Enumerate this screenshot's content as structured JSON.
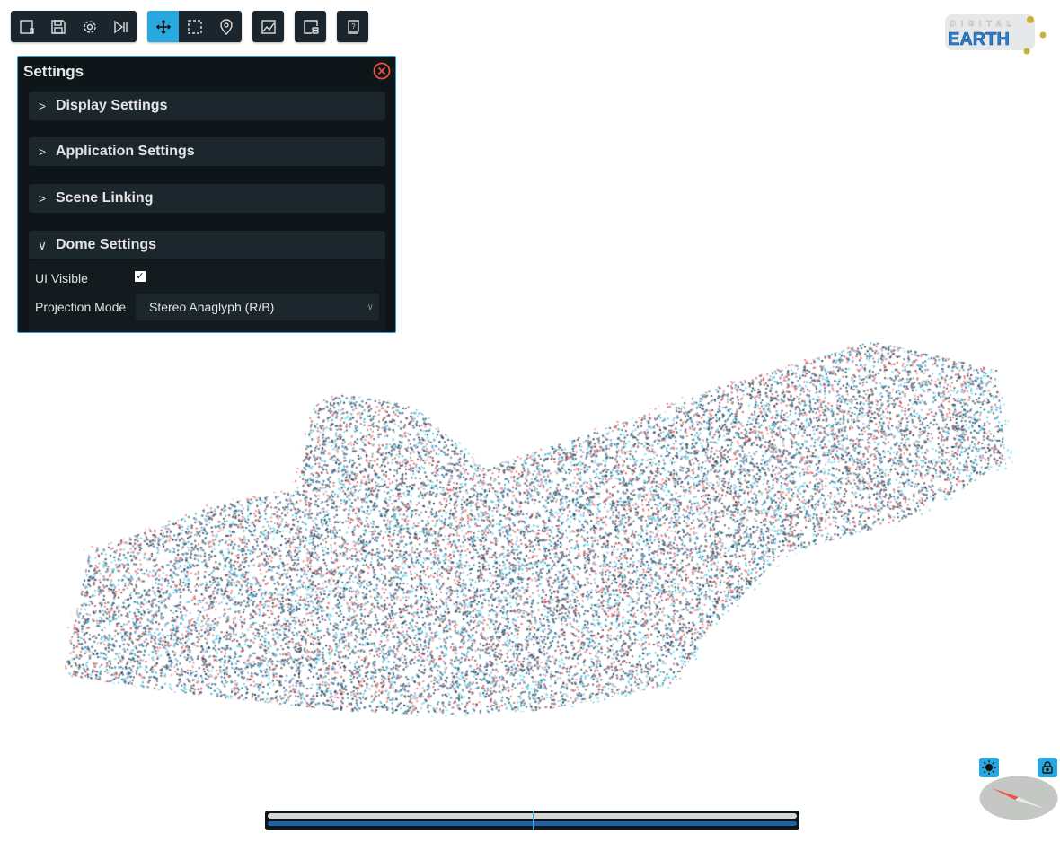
{
  "toolbar": {
    "groups": [
      {
        "buttons": [
          {
            "icon": "new-file-icon"
          },
          {
            "icon": "save-icon"
          },
          {
            "icon": "gear-icon"
          },
          {
            "icon": "play-pause-icon"
          }
        ]
      },
      {
        "buttons": [
          {
            "icon": "move-icon",
            "active": true
          },
          {
            "icon": "selection-box-icon"
          },
          {
            "icon": "location-pin-icon"
          }
        ]
      },
      {
        "buttons": [
          {
            "icon": "chart-icon"
          }
        ]
      },
      {
        "buttons": [
          {
            "icon": "layers-panel-icon"
          }
        ]
      },
      {
        "buttons": [
          {
            "icon": "help-book-icon"
          }
        ]
      }
    ],
    "accent_color": "#29a8e0"
  },
  "logo": {
    "text_top": "DIGITAL",
    "text_main": "EARTH"
  },
  "settings": {
    "title": "Settings",
    "sections": [
      {
        "label": "Display Settings",
        "expanded": false
      },
      {
        "label": "Application Settings",
        "expanded": false
      },
      {
        "label": "Scene Linking",
        "expanded": false
      },
      {
        "label": "Dome Settings",
        "expanded": true
      }
    ],
    "dome": {
      "ui_visible_label": "UI Visible",
      "ui_visible": true,
      "projection_label": "Projection Mode",
      "projection_value": "Stereo Anaglyph (R/B)"
    }
  },
  "controls": {
    "light_icon": "sun-icon",
    "lock_icon": "lock-icon"
  },
  "timeline": {
    "position": 0.5
  }
}
